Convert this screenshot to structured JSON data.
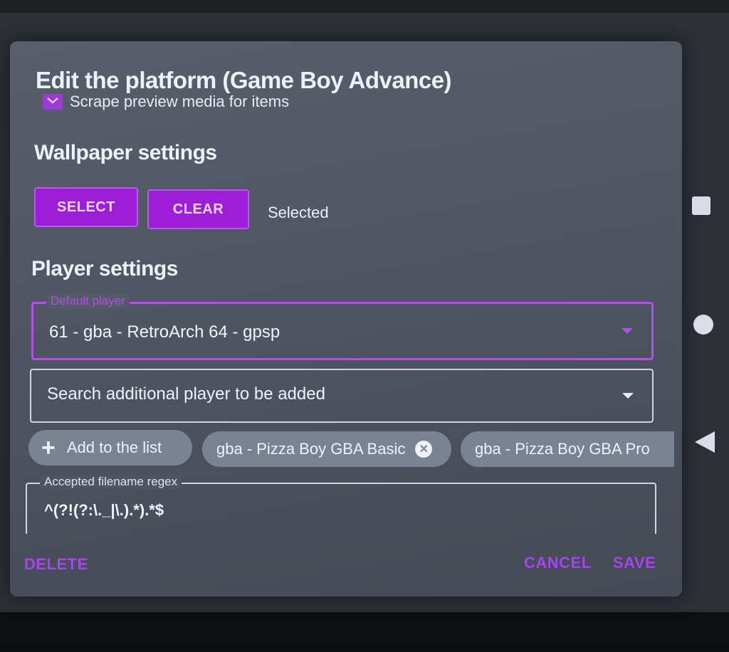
{
  "dialog": {
    "title": "Edit the platform (Game Boy Advance)",
    "scrape_checkbox": {
      "label": "Scrape preview media for items",
      "checked": true
    }
  },
  "wallpaper": {
    "title": "Wallpaper settings",
    "select_label": "SELECT",
    "clear_label": "CLEAR",
    "status": "Selected"
  },
  "player": {
    "title": "Player settings",
    "default_player_label": "Default player",
    "default_player_value": "61 - gba - RetroArch 64 - gpsp",
    "search_placeholder": "Search additional player to be added",
    "add_label": "Add to the list",
    "chips": [
      "gba - Pizza Boy GBA Basic",
      "gba - Pizza Boy GBA Pro"
    ]
  },
  "regex": {
    "label": "Accepted filename regex",
    "value": "^(?!(?:\\._|\\.).*).*$"
  },
  "actions": {
    "delete": "DELETE",
    "cancel": "CANCEL",
    "save": "SAVE"
  },
  "colors": {
    "accent": "#9d1ed8",
    "accent_text": "#a645ee",
    "dialog_bg": "#555b66",
    "chip_bg": "#7b8392"
  },
  "icons": {
    "checkbox": "check-square-icon",
    "add": "plus-icon",
    "chip_remove": "close-circle-icon",
    "dropdown": "caret-down-icon",
    "nav_recents": "square-icon",
    "nav_home": "circle-icon",
    "nav_back": "triangle-back-icon"
  }
}
